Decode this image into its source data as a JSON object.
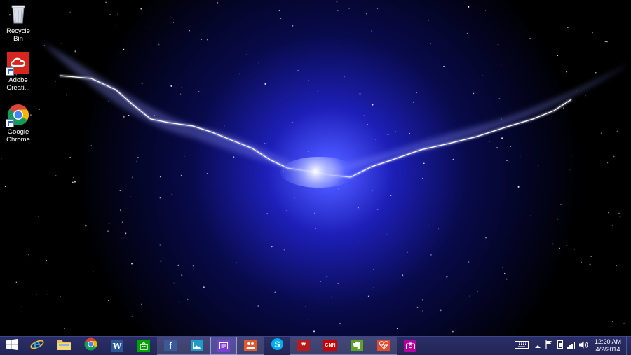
{
  "desktop": {
    "icons": [
      {
        "label": "Recycle Bin",
        "icon": "recycle-bin-icon"
      },
      {
        "label": "Adobe Creati...",
        "icon": "adobe-creative-cloud-icon"
      },
      {
        "label": "Google Chrome",
        "icon": "chrome-icon"
      }
    ]
  },
  "taskbar": {
    "start": {
      "icon": "windows-start-icon"
    },
    "pinned": [
      {
        "name": "internet-explorer",
        "icon": "internet-explorer-icon",
        "glyph": "e",
        "color": "#1fa3e8"
      },
      {
        "name": "file-explorer",
        "icon": "folder-icon",
        "color": "#e8c35a"
      },
      {
        "name": "google-chrome",
        "icon": "chrome-icon"
      },
      {
        "name": "word",
        "icon": "word-icon",
        "glyph": "W",
        "color": "#2b5797"
      },
      {
        "name": "store",
        "icon": "store-icon",
        "color": "#00a300"
      },
      {
        "name": "facebook",
        "icon": "facebook-icon",
        "glyph": "f",
        "color": "#3b5998"
      },
      {
        "name": "photos",
        "icon": "photos-icon",
        "color": "#1e9bc9"
      },
      {
        "name": "reading-list",
        "icon": "reading-list-icon",
        "color": "#7b3fd1"
      },
      {
        "name": "people",
        "icon": "people-icon",
        "color": "#e3572c"
      },
      {
        "name": "skype",
        "icon": "skype-icon",
        "glyph": "S",
        "color": "#00aff0"
      },
      {
        "name": "yelp",
        "icon": "yelp-icon",
        "glyph": "*",
        "color": "#b71c1c"
      },
      {
        "name": "cnn",
        "icon": "cnn-icon",
        "glyph": "CNN",
        "color": "#cc0000"
      },
      {
        "name": "evernote",
        "icon": "evernote-icon",
        "color": "#5ba525"
      },
      {
        "name": "health-fitness",
        "icon": "health-icon",
        "color": "#e04a2f"
      },
      {
        "name": "camera",
        "icon": "camera-icon",
        "color": "#b4009e"
      }
    ],
    "tray": {
      "icons": [
        "keyboard-icon",
        "show-hidden-icons-icon",
        "flag-icon",
        "battery-icon",
        "network-icon",
        "volume-icon"
      ],
      "time": "12:20 AM",
      "date": "4/2/2014"
    }
  },
  "colors": {
    "taskbar_bg": "#2b2f67",
    "wallpaper_glow": "#2a2bd8"
  }
}
